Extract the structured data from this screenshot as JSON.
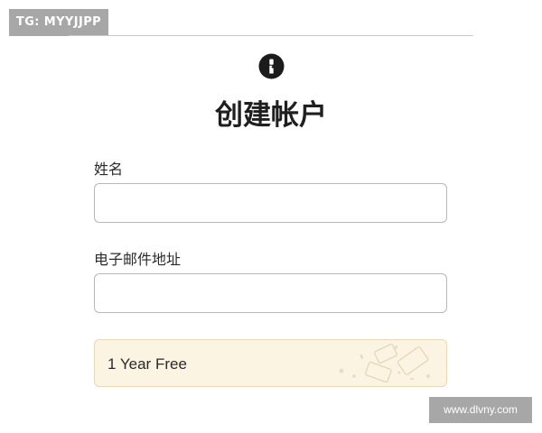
{
  "watermarks": {
    "top_left": "TG: MYYJJPP",
    "bottom_right": "www.dlvny.com"
  },
  "logo": {
    "icon": "keyhole-logo-icon"
  },
  "header": {
    "title": "创建帐户"
  },
  "form": {
    "name_label": "姓名",
    "name_value": "",
    "email_label": "电子邮件地址",
    "email_value": ""
  },
  "promo": {
    "text": "1 Year Free",
    "accent_color": "#fbf4e2"
  }
}
